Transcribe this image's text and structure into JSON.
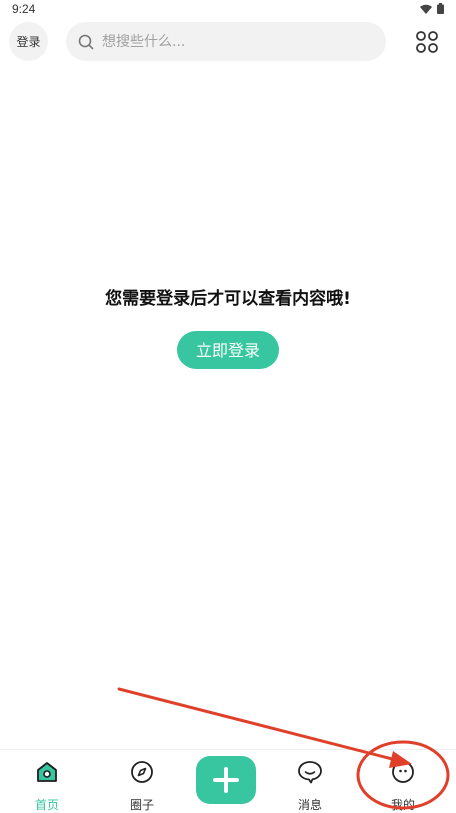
{
  "status_bar": {
    "time": "9:24"
  },
  "header": {
    "login_label": "登录",
    "search_placeholder": "想搜些什么..."
  },
  "main": {
    "prompt": "您需要登录后才可以查看内容哦!",
    "login_button": "立即登录"
  },
  "tabbar": {
    "tabs": [
      {
        "label": "首页",
        "icon": "home-icon",
        "active": true
      },
      {
        "label": "圈子",
        "icon": "compass-icon",
        "active": false
      },
      {
        "label": "",
        "icon": "add-icon",
        "active": false
      },
      {
        "label": "消息",
        "icon": "message-icon",
        "active": false
      },
      {
        "label": "我的",
        "icon": "profile-icon",
        "active": false
      }
    ]
  },
  "colors": {
    "accent": "#37c6a0",
    "annotation": "#e0402a"
  }
}
